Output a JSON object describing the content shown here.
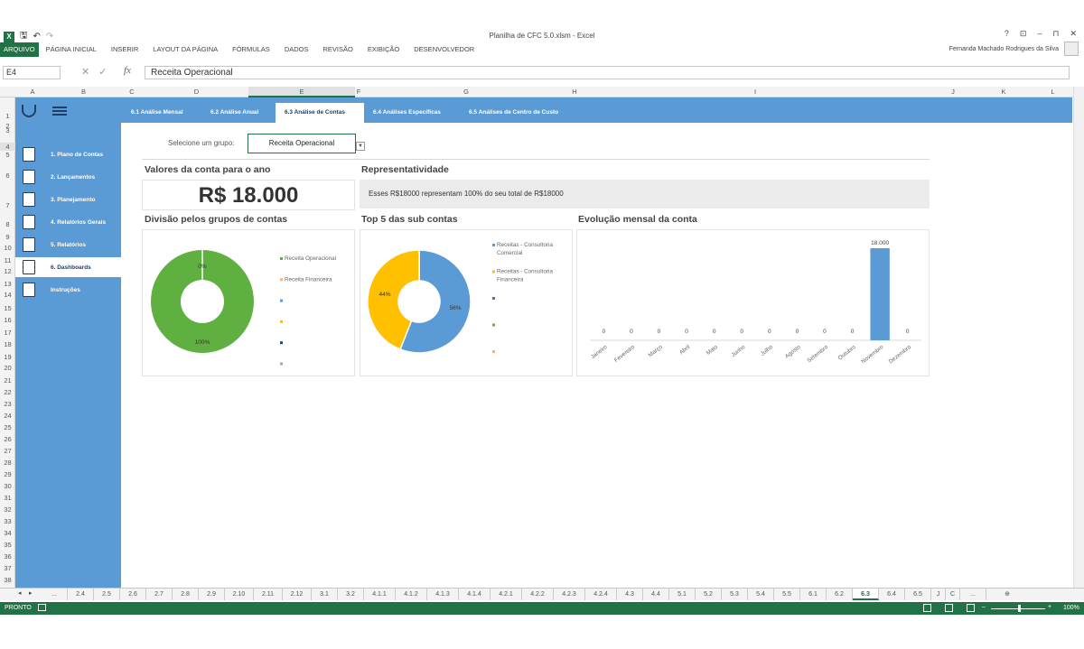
{
  "app": {
    "window_title": "Planilha de CFC 5.0.xlsm - Excel",
    "user_name": "Fernanda Machado Rodrigues da Silva",
    "window_buttons": [
      "?",
      "⊡",
      "–",
      "⊓",
      "✕"
    ],
    "ribbon_tabs": [
      "ARQUIVO",
      "PÁGINA INICIAL",
      "INSERIR",
      "LAYOUT DA PÁGINA",
      "FÓRMULAS",
      "DADOS",
      "REVISÃO",
      "EXIBIÇÃO",
      "DESENVOLVEDOR"
    ]
  },
  "formula_bar": {
    "name_box": "E4",
    "formula": "Receita Operacional",
    "fx": "fx"
  },
  "columns": [
    "A",
    "B",
    "C",
    "D",
    "E",
    "F",
    "G",
    "H",
    "I",
    "J",
    "K",
    "L"
  ],
  "rows": [
    "1",
    "2",
    "3",
    "4",
    "5",
    "6",
    "7",
    "8",
    "9",
    "10",
    "11",
    "12",
    "13",
    "14",
    "15",
    "16",
    "17",
    "18",
    "19",
    "20",
    "21",
    "22",
    "23",
    "24",
    "25",
    "26",
    "27",
    "28",
    "29",
    "30",
    "31",
    "32",
    "33",
    "34",
    "35",
    "36",
    "37",
    "38"
  ],
  "top_nav": {
    "tabs": [
      "6.1 Análise Mensal",
      "6.2 Análise Anual",
      "6.3 Análise de Contas",
      "6.4 Análises Específicas",
      "6.5 Análises de Centro de Custo"
    ],
    "active": 2
  },
  "sidebar": {
    "items": [
      "1. Plano de Contas",
      "2. Lançamentos",
      "3. Planejamento",
      "4. Relatórios Gerais",
      "5. Relatórios",
      "6. Dashboards",
      "Instruções"
    ],
    "active": 5
  },
  "selector": {
    "label": "Selecione um grupo:",
    "value": "Receita Operacional"
  },
  "kpi": {
    "title": "Valores da conta para o ano",
    "value": "R$ 18.000"
  },
  "representatividade": {
    "title": "Representatividade",
    "text": "Esses R$18000 representam 100% do seu total de R$18000"
  },
  "chart_data": [
    {
      "type": "pie",
      "title": "Divisão pelos grupos de contas",
      "categories": [
        "Receita Operacional",
        "Receita Financeira"
      ],
      "values": [
        100,
        0
      ],
      "labels": [
        "100%",
        "0%"
      ],
      "colors": [
        "#5fb040",
        "#f4b183"
      ],
      "extra_legend_colors": [
        "#5b9bd5",
        "#ffc000",
        "#264478",
        "#a5a5a5"
      ]
    },
    {
      "type": "pie",
      "title": "Top 5 das sub contas",
      "categories": [
        "Receitas - Consultoria Comercial",
        "Receitas - Consultoria Financeira"
      ],
      "values": [
        56,
        44
      ],
      "labels": [
        "56%",
        "44%"
      ],
      "colors": [
        "#5b9bd5",
        "#ffc000"
      ],
      "extra_legend_colors": [
        "#4472c4",
        "#70ad47",
        "#f4b183"
      ]
    },
    {
      "type": "bar",
      "title": "Evolução mensal da conta",
      "categories": [
        "Janeiro",
        "Fevereiro",
        "Março",
        "Abril",
        "Maio",
        "Junho",
        "Julho",
        "Agosto",
        "Setembro",
        "Outubro",
        "Novembro",
        "Dezembro"
      ],
      "values": [
        0,
        0,
        0,
        0,
        0,
        0,
        0,
        0,
        0,
        0,
        18000,
        0
      ],
      "labels": [
        "0",
        "0",
        "0",
        "0",
        "0",
        "0",
        "0",
        "0",
        "0",
        "0",
        "18.000",
        "0"
      ],
      "color": "#5b9bd5"
    }
  ],
  "sheet_tabs": {
    "items": [
      "...",
      "2.4",
      "2.5",
      "2.6",
      "2.7",
      "2.8",
      "2.9",
      "2.10",
      "2.11",
      "2.12",
      "3.1",
      "3.2",
      "4.1.1",
      "4.1.2",
      "4.1.3",
      "4.1.4",
      "4.2.1",
      "4.2.2",
      "4.2.3",
      "4.2.4",
      "4.3",
      "4.4",
      "5.1",
      "5.2",
      "5.3",
      "5.4",
      "5.5",
      "6.1",
      "6.2",
      "6.3",
      "6.4",
      "6.5",
      "J",
      "C",
      "..."
    ],
    "active": "6.3"
  },
  "status": {
    "mode": "PRONTO",
    "zoom": "100%"
  }
}
